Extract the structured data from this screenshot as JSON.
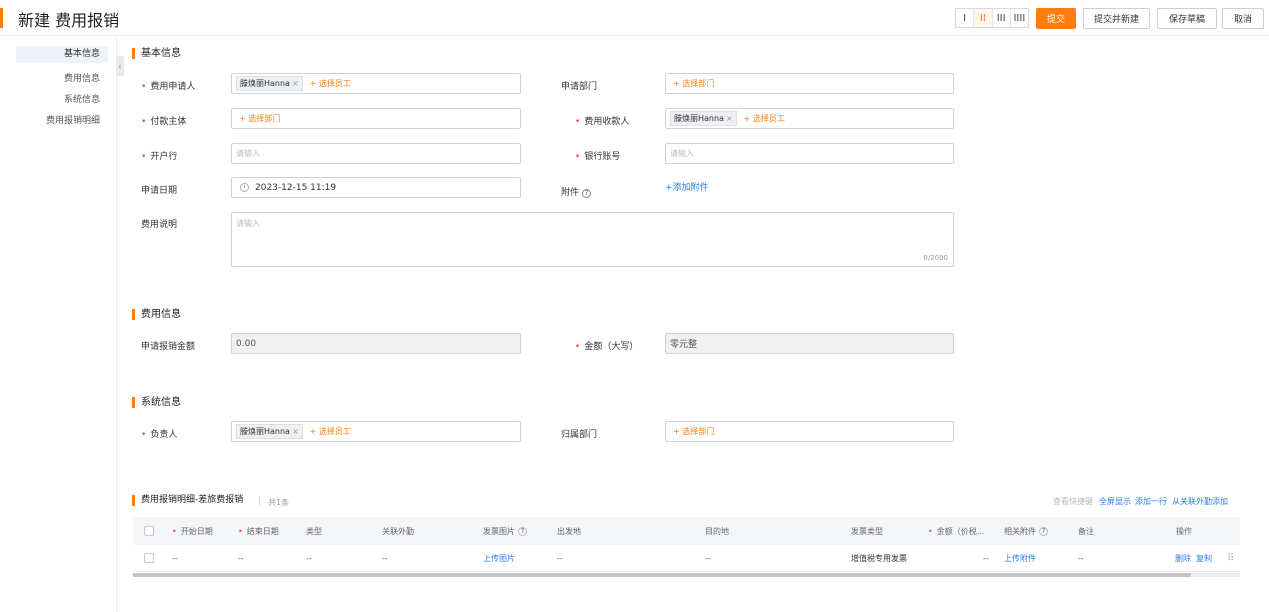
{
  "header": {
    "title": "新建 费用报销",
    "layout_options": [
      "I",
      "II",
      "III",
      "IIII"
    ],
    "layout_active": "II",
    "buttons": {
      "submit": "提交",
      "submit_new": "提交并新建",
      "save_draft": "保存草稿",
      "cancel": "取消"
    }
  },
  "sidebar": {
    "items": [
      {
        "label": "基本信息",
        "active": true
      },
      {
        "label": "费用信息",
        "active": false
      },
      {
        "label": "系统信息",
        "active": false
      },
      {
        "label": "费用报销明细",
        "active": false
      }
    ],
    "collapse_icon": "‹"
  },
  "basic": {
    "title": "基本信息",
    "applicant": {
      "label": "费用申请人",
      "tag": "滕焕丽Hanna",
      "add": "+ 选择员工"
    },
    "department": {
      "label": "申请部门",
      "add": "+ 选择部门"
    },
    "payer": {
      "label": "付款主体",
      "add": "+ 选择部门"
    },
    "payee": {
      "label": "费用收款人",
      "tag": "滕焕丽Hanna",
      "add": "+ 选择员工"
    },
    "bank": {
      "label": "开户行",
      "placeholder": "请输入"
    },
    "account": {
      "label": "银行账号",
      "placeholder": "请输入"
    },
    "date": {
      "label": "申请日期",
      "value": "2023-12-15 11:19"
    },
    "attachment": {
      "label": "附件",
      "help": "?",
      "add": "+添加附件"
    },
    "desc": {
      "label": "费用说明",
      "placeholder": "请输入",
      "counter": "0/2000"
    }
  },
  "expense": {
    "title": "费用信息",
    "amount": {
      "label": "申请报销金额",
      "value": "0.00"
    },
    "amount_cn": {
      "label": "金额（大写）",
      "value": "零元整"
    }
  },
  "system": {
    "title": "系统信息",
    "owner": {
      "label": "负责人",
      "tag": "滕焕丽Hanna",
      "add": "+ 选择员工"
    },
    "dept": {
      "label": "归属部门",
      "add": "+ 选择部门"
    }
  },
  "detail": {
    "title": "费用报销明细-差旅费报销",
    "count": "共1条",
    "actions": {
      "shortcut": "查看快捷键",
      "fullscreen": "全屏显示",
      "add_row": "添加一行",
      "add_from": "从关联外勤添加"
    },
    "columns": {
      "start": "开始日期",
      "end": "结束日期",
      "type": "类型",
      "trip": "关联外勤",
      "invoice_img": "发票图片",
      "from": "出发地",
      "to": "目的地",
      "invoice_type": "发票类型",
      "amount": "金额（价税...",
      "attach": "相关附件",
      "note": "备注",
      "ops": "操作"
    },
    "row": {
      "start": "--",
      "end": "--",
      "type": "--",
      "trip": "--",
      "upload_img": "上传图片",
      "from": "--",
      "to": "--",
      "invoice_type": "增值税专用发票",
      "amount": "--",
      "upload_attach": "上传附件",
      "note": "--",
      "delete": "删除",
      "copy": "复制"
    }
  },
  "colors": {
    "accent": "#ff7d0d",
    "link": "#2f7be6",
    "required": "#f04a3a"
  }
}
